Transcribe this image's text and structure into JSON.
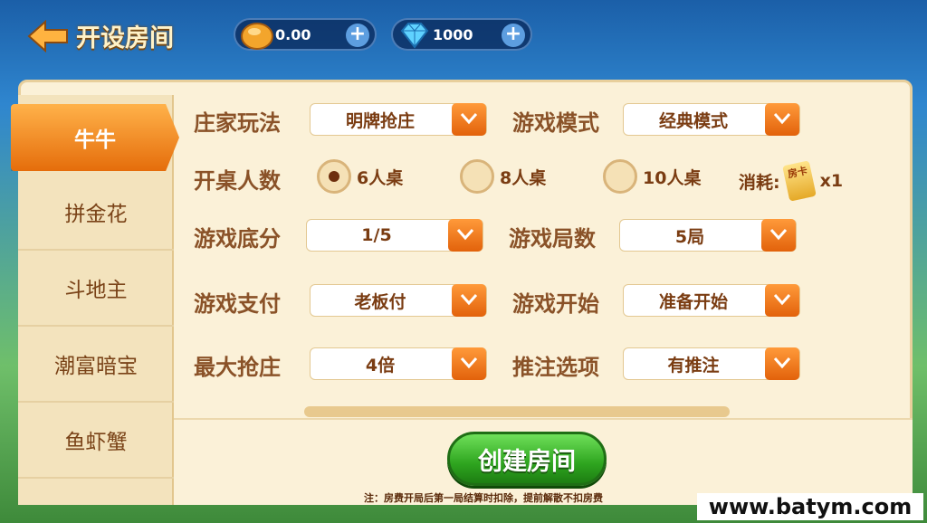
{
  "header": {
    "title": "开设房间",
    "gold": "0.00",
    "diamonds": "1000"
  },
  "sidebar": {
    "items": [
      {
        "label": "牛牛"
      },
      {
        "label": "拼金花"
      },
      {
        "label": "斗地主"
      },
      {
        "label": "潮富暗宝"
      },
      {
        "label": "鱼虾蟹"
      }
    ]
  },
  "form": {
    "banker_mode": {
      "label": "庄家玩法",
      "value": "明牌抢庄"
    },
    "game_mode": {
      "label": "游戏模式",
      "value": "经典模式"
    },
    "seats": {
      "label": "开桌人数",
      "options": [
        "6人桌",
        "8人桌",
        "10人桌"
      ],
      "selected": "6人桌"
    },
    "cost": {
      "label": "消耗:",
      "card_text": "房卡",
      "amount": "x1"
    },
    "base_score": {
      "label": "游戏底分",
      "value": "1/5"
    },
    "rounds": {
      "label": "游戏局数",
      "value": "5局"
    },
    "payment": {
      "label": "游戏支付",
      "value": "老板付"
    },
    "start": {
      "label": "游戏开始",
      "value": "准备开始"
    },
    "max_bid": {
      "label": "最大抢庄",
      "value": "4倍"
    },
    "push_bet": {
      "label": "推注选项",
      "value": "有推注"
    }
  },
  "create_button": "创建房间",
  "note": "注：房费开局后第一局结算时扣除，提前解散不扣房费",
  "watermark": "www.batym.com",
  "colors": {
    "accent_orange": "#e56d0b",
    "create_green": "#2ea51f",
    "panel_bg": "#fbf1d8",
    "label_brown": "#8a5228"
  }
}
